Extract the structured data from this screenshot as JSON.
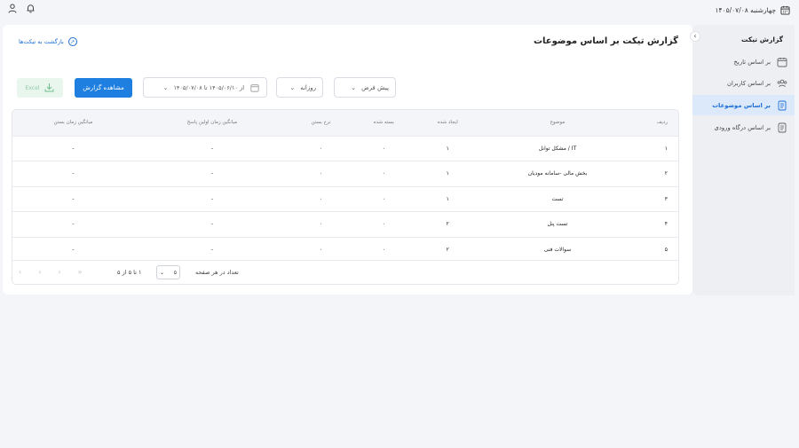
{
  "topbar": {
    "date": "چهارشنبه ۱۴۰۵/۰۷/۰۸",
    "icons": [
      "calendar-icon",
      "bell-icon",
      "user-icon"
    ]
  },
  "sidebar": {
    "title": "گزارش تیکت",
    "items": [
      {
        "label": "بر اساس تاریخ",
        "icon": "calendar-icon",
        "active": false
      },
      {
        "label": "بر اساس کاربران",
        "icon": "users-icon",
        "active": false
      },
      {
        "label": "بر اساس موضوعات",
        "icon": "document-icon",
        "active": true
      },
      {
        "label": "بر اساس درگاه ورودی",
        "icon": "document-icon",
        "active": false
      }
    ]
  },
  "page": {
    "title": "گزارش تیکت بر اساس موضوعات",
    "back_label": "بازگشت به تیکت‌ها"
  },
  "filters": {
    "preset": "پیش فرض",
    "period": "روزانه",
    "date_range": "از ۱۴۰۵/۰۶/۱۰ تا ۱۴۰۵/۰۷/۰۸",
    "report_button": "مشاهده گزارش",
    "excel_button": "Excel"
  },
  "table": {
    "headers": [
      "ردیف",
      "موضوع",
      "ایجاد شده",
      "بسته شده",
      "نرخ بستن",
      "میانگین زمان اولین پاسخ",
      "میانگین زمان بستن"
    ],
    "rows": [
      [
        "۱",
        "IT / مشکل توانل",
        "۱",
        "۰",
        "۰",
        "-",
        "-"
      ],
      [
        "۲",
        "بخش مالی -سامانه مودیان",
        "۱",
        "۰",
        "۰",
        "-",
        "-"
      ],
      [
        "۳",
        "تست",
        "۱",
        "۰",
        "۰",
        "-",
        "-"
      ],
      [
        "۴",
        "تست پنل",
        "۲",
        "۰",
        "۰",
        "-",
        "-"
      ],
      [
        "۵",
        "سوالات فنی",
        "۲",
        "۰",
        "۰",
        "-",
        "-"
      ]
    ]
  },
  "pagination": {
    "per_page_label": "تعداد در هر صفحه",
    "per_page_value": "۵",
    "range_text": "۱ تا ۵ از ۵"
  },
  "colors": {
    "accent": "#1f7fe0",
    "active_bg": "#dce9fb",
    "excel_bg": "#e8f6ee"
  }
}
